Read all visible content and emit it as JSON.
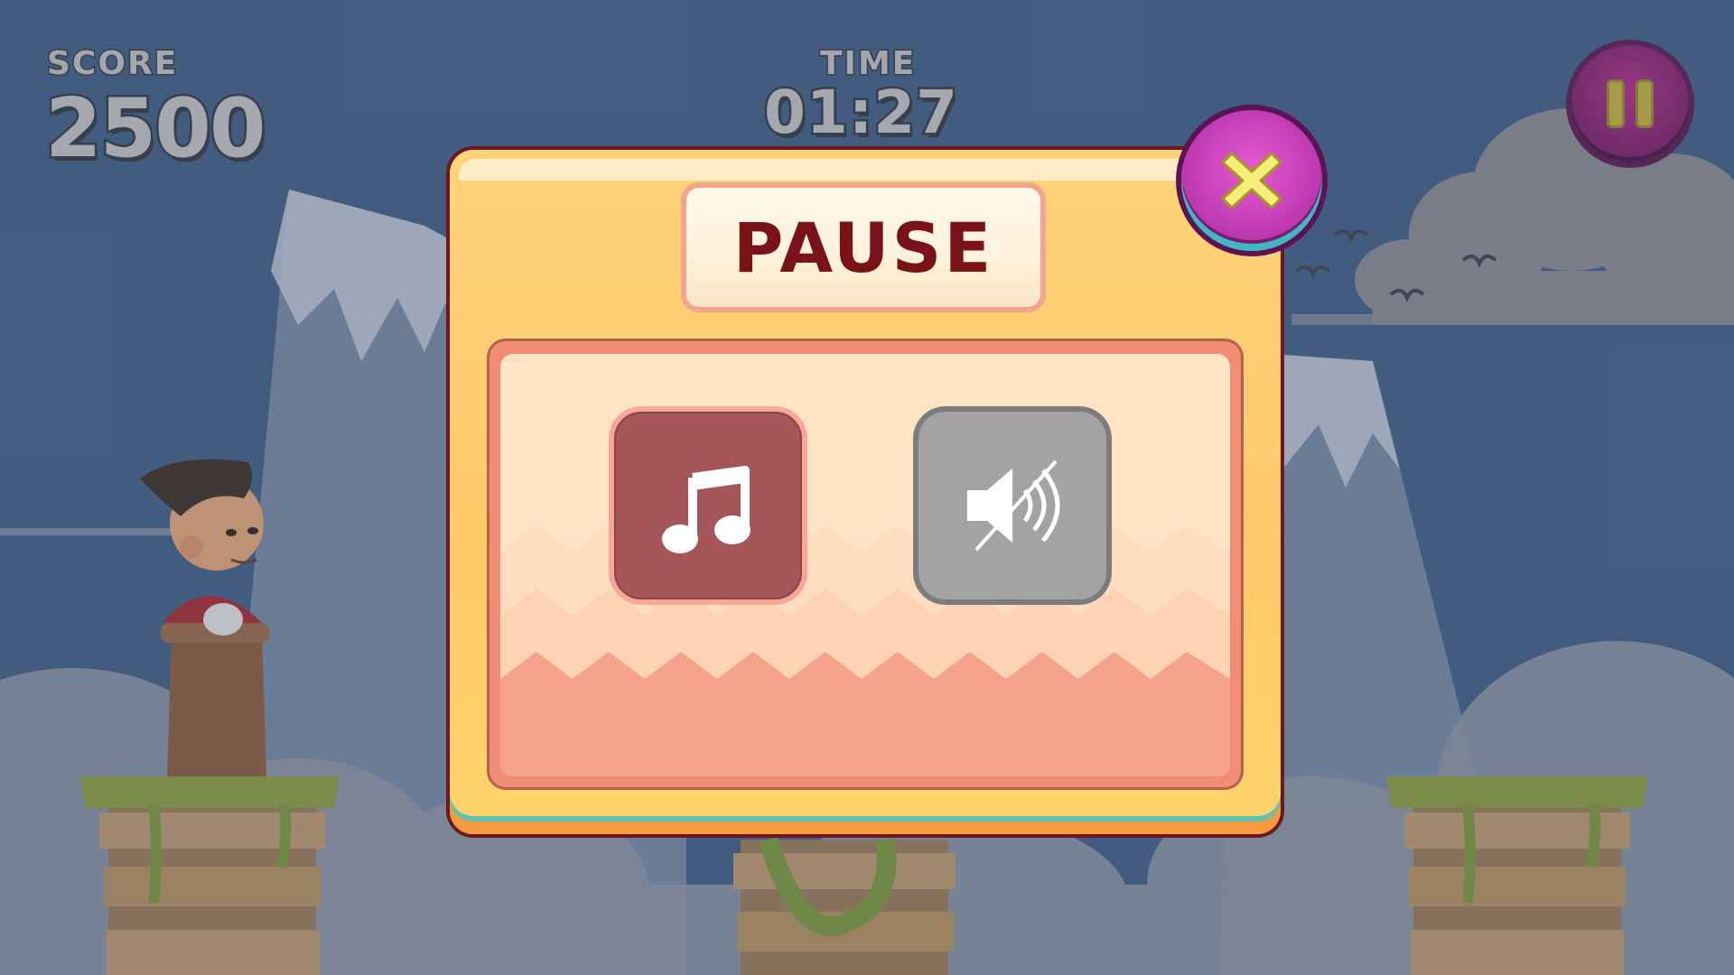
{
  "hud": {
    "score_label": "SCORE",
    "score_value": "2500",
    "time_label": "TIME",
    "time_value": "01:27"
  },
  "pause_modal": {
    "title": "PAUSE",
    "options": [
      {
        "name": "music",
        "icon": "music-note-icon",
        "state": "on"
      },
      {
        "name": "sound",
        "icon": "speaker-muted-icon",
        "state": "off"
      }
    ]
  },
  "colors": {
    "sky": "#3c5d85",
    "modal_title": "#7a121a",
    "music_button": "#a45658",
    "sound_button_off": "#a3a3a3",
    "close_button": "#c23db4",
    "pause_button": "#7b1a68"
  },
  "icons": {
    "pause": "pause-icon",
    "close": "close-x-icon"
  }
}
